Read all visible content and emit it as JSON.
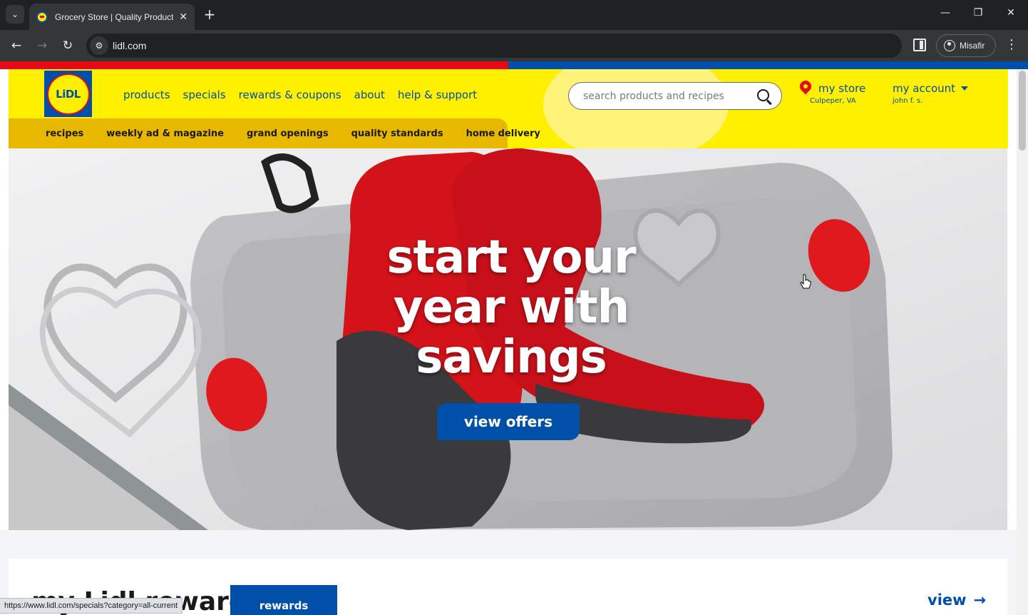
{
  "browser": {
    "tab_title": "Grocery Store | Quality Products",
    "tab_close": "✕",
    "new_tab": "+",
    "url": "lidl.com",
    "profile_name": "Misafir",
    "status_url": "https://www.lidl.com/specials?category=all-current"
  },
  "header": {
    "logo_text": "LiDL",
    "nav": [
      "products",
      "specials",
      "rewards & coupons",
      "about",
      "help & support"
    ],
    "search_placeholder": "search products and recipes",
    "store": {
      "title": "my store",
      "location": "Culpeper, VA"
    },
    "account": {
      "title": "my account",
      "user": "john f. s."
    },
    "subnav": [
      "recipes",
      "weekly ad & magazine",
      "grand openings",
      "quality standards",
      "home delivery"
    ]
  },
  "hero": {
    "heading": "start your year with savings",
    "cta": "view offers"
  },
  "rewards": {
    "heading": "my Lidl rewards",
    "button": "rewards",
    "view_link": "view"
  },
  "colors": {
    "brand_yellow": "#fff000",
    "brand_blue": "#0050aa",
    "brand_red": "#e60a14",
    "subnav_yellow": "#e8b800"
  }
}
